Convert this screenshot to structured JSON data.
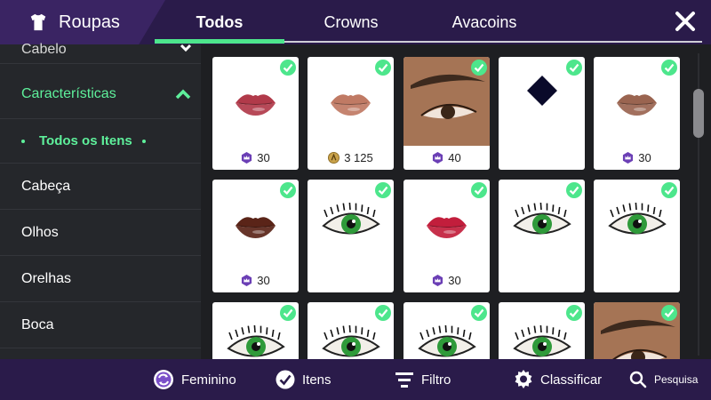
{
  "header": {
    "title": "Roupas",
    "tabs": [
      {
        "label": "Todos",
        "active": true
      },
      {
        "label": "Crowns",
        "active": false
      },
      {
        "label": "Avacoins",
        "active": false
      }
    ]
  },
  "sidebar": {
    "partial_item": "Cabelo",
    "expanded_section": "Características",
    "sub_item_active": "Todos os Itens",
    "items": [
      "Cabeça",
      "Olhos",
      "Orelhas",
      "Boca"
    ]
  },
  "grid": {
    "items": [
      {
        "kind": "lips",
        "color": "#b13a4a",
        "price": "30",
        "currency": "crowns"
      },
      {
        "kind": "lips",
        "color": "#c07a64",
        "price": "3 125",
        "currency": "avacoins"
      },
      {
        "kind": "brow-photo",
        "price": "40",
        "currency": "crowns"
      },
      {
        "kind": "diamond",
        "price": "",
        "currency": ""
      },
      {
        "kind": "lips",
        "color": "#9a6450",
        "price": "30",
        "currency": "crowns"
      },
      {
        "kind": "lips",
        "color": "#5a2418",
        "price": "30",
        "currency": "crowns"
      },
      {
        "kind": "eye-green",
        "price": "",
        "currency": ""
      },
      {
        "kind": "lips",
        "color": "#c21e3c",
        "price": "30",
        "currency": "crowns"
      },
      {
        "kind": "eye-green",
        "price": "",
        "currency": ""
      },
      {
        "kind": "eye-green",
        "price": "",
        "currency": ""
      },
      {
        "kind": "eye-green",
        "price": "",
        "currency": ""
      },
      {
        "kind": "eye-green",
        "price": "",
        "currency": ""
      },
      {
        "kind": "eye-green",
        "price": "",
        "currency": ""
      },
      {
        "kind": "eye-green",
        "price": "",
        "currency": ""
      },
      {
        "kind": "brow-photo",
        "price": "",
        "currency": ""
      }
    ]
  },
  "bottom": {
    "gender": "Feminino",
    "itens": "Itens",
    "filtro": "Filtro",
    "classificar": "Classificar",
    "pesquisa": "Pesquisa"
  },
  "colors": {
    "accent": "#4de68c",
    "header_bg": "#2a1b4a",
    "crown_badge": "#6b3fb5",
    "avacoin": "#c9a24a"
  }
}
